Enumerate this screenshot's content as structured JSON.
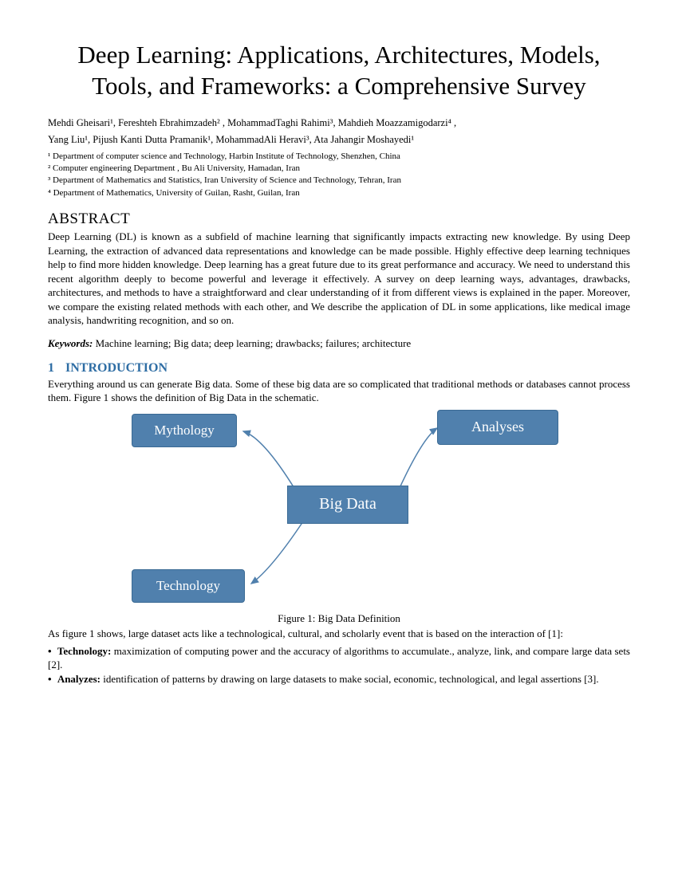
{
  "title": "Deep Learning: Applications, Architectures, Models, Tools, and Frameworks: a Comprehensive Survey",
  "authors_line1": "Mehdi Gheisari¹, Fereshteh Ebrahimzadeh² , MohammadTaghi Rahimi³, Mahdieh Moazzamigodarzi⁴ ,",
  "authors_line2": "Yang Liu¹, Pijush Kanti Dutta Pramanik¹, MohammadAli Heravi³, Ata Jahangir Moshayedi¹",
  "affiliations": {
    "a1": "¹ Department of computer science and Technology, Harbin Institute of Technology, Shenzhen, China",
    "a2": "² Computer engineering Department , Bu Ali University, Hamadan, Iran",
    "a3": "³ Department of Mathematics and Statistics, Iran University of Science and Technology, Tehran, Iran",
    "a4": "⁴ Department of Mathematics, University of Guilan, Rasht, Guilan, Iran"
  },
  "abstract_heading": "ABSTRACT",
  "abstract_text": "Deep Learning (DL) is known as a subfield of machine learning that significantly impacts extracting new knowledge. By using Deep Learning, the extraction of advanced data representations and knowledge can be made possible. Highly effective deep learning techniques help to find more hidden knowledge. Deep learning has a great future due to its great performance and accuracy. We need to understand this recent algorithm deeply to become powerful and leverage it effectively. A survey on deep learning ways, advantages, drawbacks, architectures, and methods to have a straightforward and clear understanding of it from different views is explained in the paper. Moreover, we compare the existing related methods with each other, and We describe the application of DL in some applications, like  medical image analysis, handwriting recognition, and so on.",
  "keywords_label": "Keywords:",
  "keywords_text": " Machine learning; Big data; deep learning; drawbacks; failures; architecture",
  "section1": {
    "num": "1",
    "title": "INTRODUCTION"
  },
  "intro_text": "Everything around us can generate Big data. Some of these big data are so complicated that traditional methods or databases cannot process them. Figure 1 shows the definition of Big Data in the schematic.",
  "diagram": {
    "mythology": "Mythology",
    "analyses": "Analyses",
    "bigdata": "Big Data",
    "technology": "Technology"
  },
  "figure_caption": "Figure 1: Big Data Definition",
  "post_figure_text": "As figure 1 shows, large dataset acts like a technological, cultural, and scholarly event that is based on the interaction of [1]:",
  "bullets": {
    "tech_label": "Technology:",
    "tech_text": " maximization of computing power and the accuracy of algorithms to accumulate., analyze, link, and compare large data sets [2].",
    "ana_label": "Analyzes:",
    "ana_text": " identification of patterns by drawing on large datasets to make social, economic, technological, and legal assertions [3]."
  }
}
